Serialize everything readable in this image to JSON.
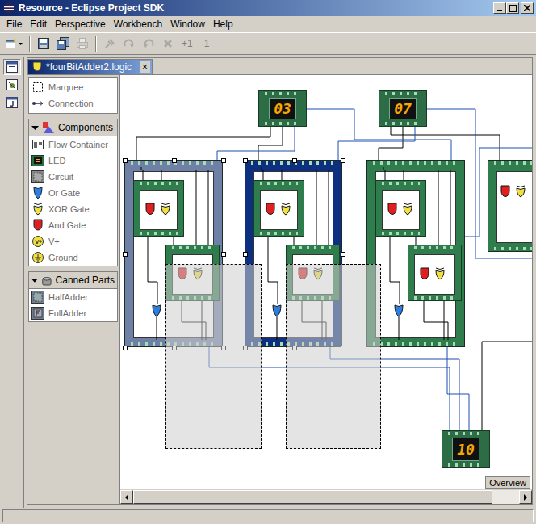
{
  "window": {
    "title": "Resource - Eclipse Project SDK"
  },
  "menu": [
    {
      "label": "File"
    },
    {
      "label": "Edit"
    },
    {
      "label": "Perspective"
    },
    {
      "label": "Workbench"
    },
    {
      "label": "Window"
    },
    {
      "label": "Help"
    }
  ],
  "toolbar": [
    {
      "kind": "new",
      "disabled": false
    },
    {
      "kind": "separator",
      "disabled": false
    },
    {
      "kind": "save",
      "disabled": false
    },
    {
      "kind": "saveall",
      "disabled": false
    },
    {
      "kind": "print",
      "disabled": true
    },
    {
      "kind": "separator",
      "disabled": false
    },
    {
      "kind": "pin",
      "disabled": true
    },
    {
      "kind": "forward",
      "disabled": true
    },
    {
      "kind": "back",
      "disabled": true
    },
    {
      "kind": "delete",
      "disabled": true
    },
    {
      "kind": "text",
      "label": "+1",
      "disabled": true
    },
    {
      "kind": "text",
      "label": "-1",
      "disabled": true
    }
  ],
  "perspectives": [
    {
      "selected": true
    },
    {
      "selected": false
    },
    {
      "selected": false
    }
  ],
  "editor_tab": {
    "label": "*fourBitAdder2.logic",
    "close": "×",
    "selected": true
  },
  "palette": {
    "tools": [
      {
        "label": "Marquee",
        "kind": "marquee",
        "selected": false
      },
      {
        "label": "Connection",
        "kind": "connection",
        "selected": false
      }
    ],
    "drawers": [
      {
        "label": "Components",
        "expanded": true,
        "items": [
          {
            "label": "Flow Container",
            "kind": "flow"
          },
          {
            "label": "LED",
            "kind": "led"
          },
          {
            "label": "Circuit",
            "kind": "circuit"
          },
          {
            "label": "Or Gate",
            "kind": "or"
          },
          {
            "label": "XOR Gate",
            "kind": "xor"
          },
          {
            "label": "And Gate",
            "kind": "and"
          },
          {
            "label": "V+",
            "kind": "vplus"
          },
          {
            "label": "Ground",
            "kind": "ground"
          }
        ]
      },
      {
        "label": "Canned Parts",
        "expanded": true,
        "items": [
          {
            "label": "HalfAdder",
            "kind": "halfadder"
          },
          {
            "label": "FullAdder",
            "kind": "fulladder"
          }
        ]
      }
    ]
  },
  "diagram": {
    "leds": [
      {
        "value": "03"
      },
      {
        "value": "07"
      },
      {
        "value": "10"
      }
    ],
    "circuits": [
      {
        "kind": "full",
        "selected": true,
        "dragging": true,
        "color": "#6f80a6"
      },
      {
        "kind": "full",
        "selected": true,
        "dragging": true,
        "color": "#0d2f80"
      },
      {
        "kind": "full",
        "selected": false,
        "dragging": false,
        "color": "#2f7d4c"
      },
      {
        "kind": "half",
        "selected": false,
        "dragging": false,
        "color": "#2f7d4c"
      }
    ]
  },
  "overview": {
    "label": "Overview"
  },
  "hscrollbar": {
    "level": 0.93
  }
}
